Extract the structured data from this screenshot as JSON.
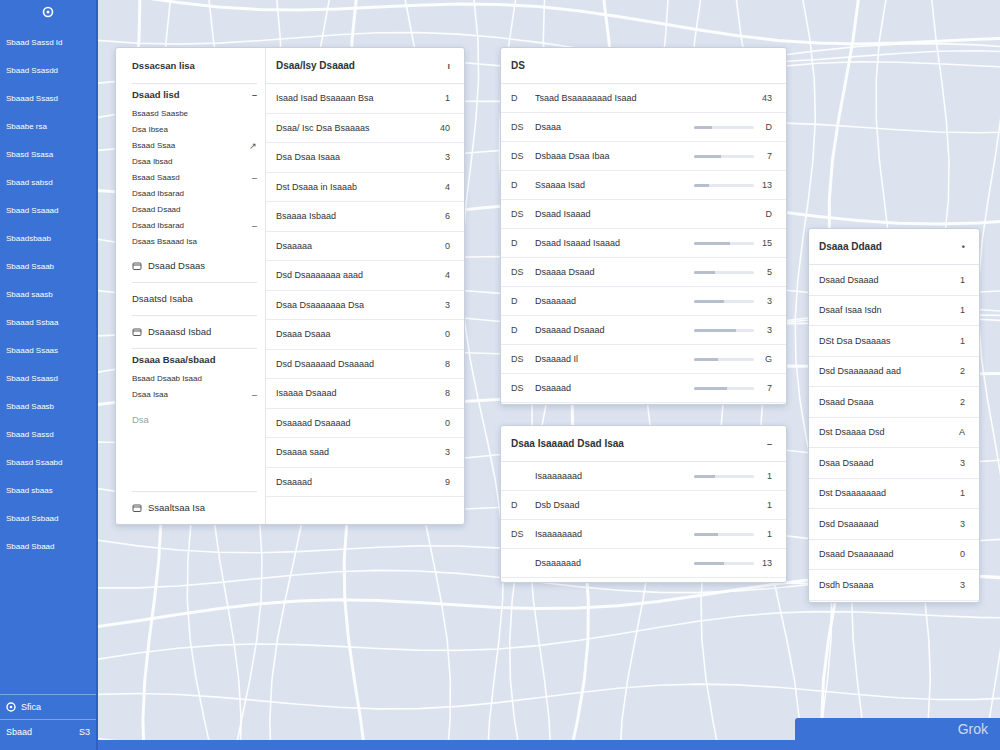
{
  "sidebar": {
    "items": [
      "Sbaad Sassd Id",
      "Sbaad Ssasdd",
      "Sbaaad Ssasd",
      "Sbaabe rsa",
      "Sbasd Ssasa",
      "Sbaad sabsd",
      "Sbaad Ssaaad",
      "Sbaadsbaab",
      "Sbaad Ssaab",
      "Sbaad saasb",
      "Sbaaad Ssbaa",
      "Sbaaad Ssaas",
      "Sbaad Ssaasd",
      "Sbaad Saasb",
      "Sbaad Sassd",
      "Sbaasd Ssaabd",
      "Sbaad sbaas",
      "Sbaad Ssbaad",
      "Sbaad Sbaad"
    ],
    "footer_item": "Sfica",
    "footer_label": "Sbaad",
    "footer_badge": "S3"
  },
  "directory": {
    "left": [
      {
        "kind": "title",
        "label": "Dssacsan lisa",
        "mark": ""
      },
      {
        "kind": "group",
        "label": "Dsaad lisd",
        "mark": "–"
      },
      {
        "kind": "sub",
        "label": "Bsaasd Saasbe",
        "mark": ""
      },
      {
        "kind": "sub",
        "label": "Dsa Ibsea",
        "mark": ""
      },
      {
        "kind": "sub",
        "label": "Bsaad Ssaa",
        "mark": "↗"
      },
      {
        "kind": "sub",
        "label": "Dsaa Ibsad",
        "mark": ""
      },
      {
        "kind": "sub",
        "label": "Bsaad Saasd",
        "mark": "–"
      },
      {
        "kind": "sub",
        "label": "Dsaad Ibsarad",
        "mark": ""
      },
      {
        "kind": "sub",
        "label": "Dsaad Dsaad",
        "mark": ""
      },
      {
        "kind": "sub",
        "label": "Dsaad Ibsarad",
        "mark": "–"
      },
      {
        "kind": "sub",
        "label": "Dsaas Bsaaad Isa",
        "mark": ""
      },
      {
        "kind": "icon",
        "label": "Dsaad Dsaas",
        "mark": ""
      },
      {
        "kind": "plain",
        "label": "Dsaatsd Isaba",
        "mark": ""
      },
      {
        "kind": "icon",
        "label": "Dsaaasd Isbad",
        "mark": ""
      },
      {
        "kind": "group",
        "label": "Dsaaa Bsaa/sbaad",
        "mark": ""
      },
      {
        "kind": "sub",
        "label": "Bsaad Dsaab Isaad",
        "mark": ""
      },
      {
        "kind": "sub",
        "label": "Dsaa Isaa",
        "mark": "–"
      },
      {
        "kind": "muted",
        "label": "Dsa",
        "mark": ""
      },
      {
        "kind": "footer",
        "label": "Ssaaltsaa Isa",
        "mark": ""
      }
    ],
    "right": {
      "title": "Dsaa/Isy Dsaaad",
      "title_mark": "ı",
      "rows": [
        {
          "label": "Isaad Isad Bsaaaan Bsa",
          "value": "1"
        },
        {
          "label": "Dsaa/ Isc Dsa Bsaaaas",
          "value": "40"
        },
        {
          "label": "Dsa Dsaa Isaaa",
          "value": "3"
        },
        {
          "label": "Dst Dsaaa in Isaaab",
          "value": "4"
        },
        {
          "label": "Bsaaaa Isbaad",
          "value": "6"
        },
        {
          "label": "Dsaaaaa",
          "value": "0"
        },
        {
          "label": "Dsd Dsaaaaaaa aaad",
          "value": "4"
        },
        {
          "label": "Dsaa Dsaaaaaaa Dsa",
          "value": "3"
        },
        {
          "label": "Dsaaa Dsaaa",
          "value": "0"
        },
        {
          "label": "Dsd Dsaaaaad Dsaaaad",
          "value": "8"
        },
        {
          "label": "Isaaaa Dsaaad",
          "value": "8"
        },
        {
          "label": "Dsaaaad Dsaaaad",
          "value": "0"
        },
        {
          "label": "Dsaaaa saad",
          "value": "3"
        },
        {
          "label": "Dsaaaad",
          "value": "9"
        }
      ]
    }
  },
  "levels": {
    "title": "DS",
    "rows": [
      {
        "kind": "plain",
        "code": "D",
        "label": "Tsaad Bsaaaaaaad Isaad",
        "value": "43"
      },
      {
        "kind": "meter",
        "code": "DS",
        "label": "Dsaaa",
        "level": 0.3,
        "value": "D"
      },
      {
        "kind": "meter",
        "code": "DS",
        "label": "Dsbaaa  Dsaa Ibaa",
        "level": 0.45,
        "value": "7"
      },
      {
        "kind": "meter",
        "code": "D",
        "label": "Ssaaaa Isad",
        "level": 0.25,
        "value": "13"
      },
      {
        "kind": "plain",
        "code": "DS",
        "label": "Dsaad Isaaad",
        "value": "D"
      },
      {
        "kind": "meter",
        "code": "D",
        "label": "Dsaad Isaaad Isaaad",
        "level": 0.6,
        "value": "15"
      },
      {
        "kind": "meter",
        "code": "DS",
        "label": "Dsaaaa Dsaad",
        "level": 0.35,
        "value": "5"
      },
      {
        "kind": "meter",
        "code": "D",
        "label": "Dsaaaaad",
        "level": 0.5,
        "value": "3"
      },
      {
        "kind": "meter",
        "code": "D",
        "label": "Dsaaaad Dsaaad",
        "level": 0.7,
        "value": "3"
      },
      {
        "kind": "meter",
        "code": "DS",
        "label": "Dsaaaad Il",
        "level": 0.4,
        "value": "G"
      },
      {
        "kind": "meter",
        "code": "DS",
        "label": "Dsaaaad",
        "level": 0.55,
        "value": "7"
      }
    ]
  },
  "summary": {
    "title": "Dsaa Isaaaad Dsad Isaa",
    "title_mark": "–",
    "rows": [
      {
        "kind": "meter",
        "code": "",
        "label": "Isaaaaaaad",
        "level": 0.35,
        "value": "1"
      },
      {
        "kind": "plain",
        "code": "D",
        "label": "Dsb Dsaad",
        "value": "1"
      },
      {
        "kind": "meter",
        "code": "DS",
        "label": "Isaaaaaaad",
        "level": 0.4,
        "value": "1"
      },
      {
        "kind": "meter",
        "code": "",
        "label": "Dsaaaaaad",
        "level": 0.5,
        "value": "13"
      }
    ]
  },
  "counts": {
    "title": "Dsaaa Ddaad",
    "title_mark": "•",
    "rows": [
      {
        "label": "Dsaad Dsaaad",
        "value": "1"
      },
      {
        "label": "Dsaaf Isaa Isdn",
        "value": "1"
      },
      {
        "label": "DSt Dsa Dsaaaas",
        "value": "1"
      },
      {
        "label": "Dsd Dsaaaaaad aad",
        "value": "2"
      },
      {
        "label": "Dsaad Dsaaa",
        "value": "2"
      },
      {
        "label": "Dst Dsaaaa Dsd",
        "value": "A"
      },
      {
        "label": "Dsaa Dsaaad",
        "value": "3"
      },
      {
        "label": "Dst Dsaaaaaaad",
        "value": "1"
      },
      {
        "label": "Dsd Dsaaaaad",
        "value": "3"
      },
      {
        "label": "Dsaad Dsaaaaaad",
        "value": "0"
      },
      {
        "label": "Dsdh Dsaaaa",
        "value": "3"
      }
    ]
  },
  "watermark": "Grok"
}
